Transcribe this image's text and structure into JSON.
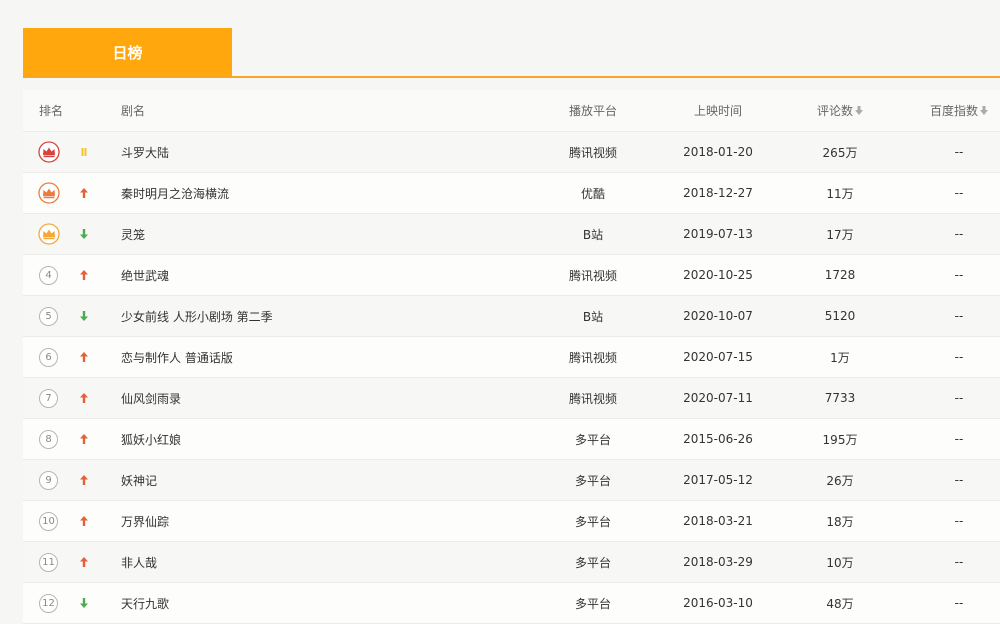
{
  "tabs": {
    "active_label": "日榜"
  },
  "headers": {
    "rank": "排名",
    "name": "剧名",
    "platform": "播放平台",
    "release": "上映时间",
    "comments": "评论数",
    "baidu": "百度指数"
  },
  "colors": {
    "accent": "#ffa70d",
    "up": "#e5603a",
    "down": "#4caa52",
    "same": "#f5c330",
    "crown1": "#d6453d",
    "crown2": "#ec7a3e",
    "crown3": "#f5a73a"
  },
  "rows": [
    {
      "rank": "1",
      "trend": "same",
      "name": "斗罗大陆",
      "platform": "腾讯视频",
      "date": "2018-01-20",
      "comments": "265万",
      "baidu": "--"
    },
    {
      "rank": "2",
      "trend": "up",
      "name": "秦时明月之沧海横流",
      "platform": "优酷",
      "date": "2018-12-27",
      "comments": "11万",
      "baidu": "--"
    },
    {
      "rank": "3",
      "trend": "down",
      "name": "灵笼",
      "platform": "B站",
      "date": "2019-07-13",
      "comments": "17万",
      "baidu": "--"
    },
    {
      "rank": "4",
      "trend": "up",
      "name": "绝世武魂",
      "platform": "腾讯视频",
      "date": "2020-10-25",
      "comments": "1728",
      "baidu": "--"
    },
    {
      "rank": "5",
      "trend": "down",
      "name": "少女前线 人形小剧场 第二季",
      "platform": "B站",
      "date": "2020-10-07",
      "comments": "5120",
      "baidu": "--"
    },
    {
      "rank": "6",
      "trend": "up",
      "name": "恋与制作人 普通话版",
      "platform": "腾讯视频",
      "date": "2020-07-15",
      "comments": "1万",
      "baidu": "--"
    },
    {
      "rank": "7",
      "trend": "up",
      "name": "仙风剑雨录",
      "platform": "腾讯视频",
      "date": "2020-07-11",
      "comments": "7733",
      "baidu": "--"
    },
    {
      "rank": "8",
      "trend": "up",
      "name": "狐妖小红娘",
      "platform": "多平台",
      "date": "2015-06-26",
      "comments": "195万",
      "baidu": "--"
    },
    {
      "rank": "9",
      "trend": "up",
      "name": "妖神记",
      "platform": "多平台",
      "date": "2017-05-12",
      "comments": "26万",
      "baidu": "--"
    },
    {
      "rank": "10",
      "trend": "up",
      "name": "万界仙踪",
      "platform": "多平台",
      "date": "2018-03-21",
      "comments": "18万",
      "baidu": "--"
    },
    {
      "rank": "11",
      "trend": "up",
      "name": "非人哉",
      "platform": "多平台",
      "date": "2018-03-29",
      "comments": "10万",
      "baidu": "--"
    },
    {
      "rank": "12",
      "trend": "down",
      "name": "天行九歌",
      "platform": "多平台",
      "date": "2016-03-10",
      "comments": "48万",
      "baidu": "--"
    }
  ]
}
